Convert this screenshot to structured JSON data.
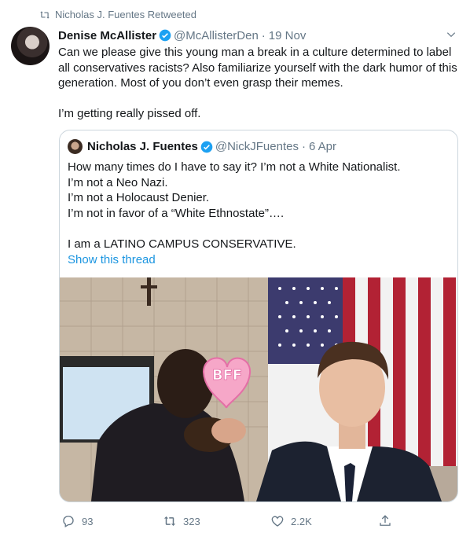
{
  "retweet": {
    "text": "Nicholas J. Fuentes Retweeted",
    "icon": "retweet-icon"
  },
  "tweet": {
    "author_name": "Denise McAllister",
    "author_handle": "@McAllisterDen",
    "separator": "·",
    "date": "19 Nov",
    "text": "Can we please give this young man a break in a culture determined to label\nall conservatives racists? Also familiarize yourself with the dark humor of this\ngeneration. Most of you don’t even grasp their memes.\n\nI’m getting really pissed off."
  },
  "quoted": {
    "author_name": "Nicholas J. Fuentes",
    "author_handle": "@NickJFuentes",
    "separator": "·",
    "date": "6 Apr",
    "text": "How many times do I have to say it? I’m not a White Nationalist.\nI’m not a Neo Nazi.\nI’m not a Holocaust Denier.\nI’m not in favor of a “White Ethnostate”….\n\nI am a LATINO CAMPUS CONSERVATIVE.",
    "thread_link": "Show this thread",
    "sticker_text": "BFF"
  },
  "actions": {
    "replies": "93",
    "retweets": "323",
    "likes": "2.2K"
  },
  "colors": {
    "text": "#14171a",
    "muted": "#657786",
    "link": "#1b95e0",
    "verified": "#1da1f2",
    "border": "#ccd6dd"
  }
}
